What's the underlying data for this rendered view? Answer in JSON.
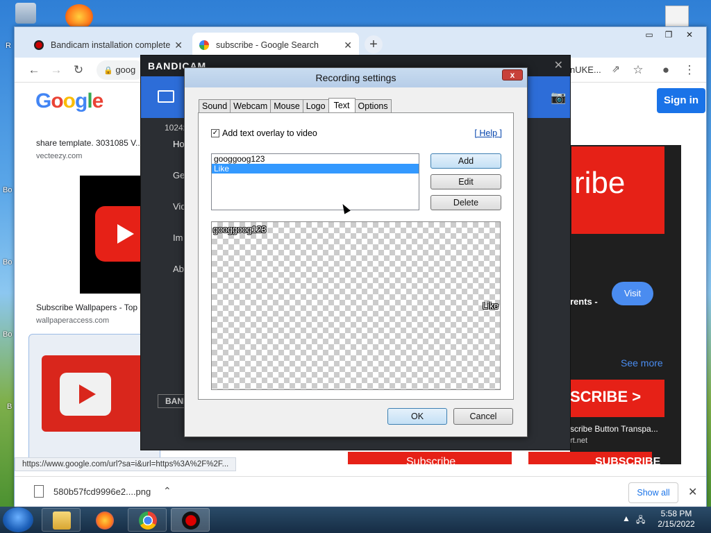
{
  "desktop": {
    "labels": [
      "R",
      "Bo",
      "Bo",
      "Bo",
      "B"
    ]
  },
  "browser": {
    "tabs": [
      {
        "label": "Bandicam installation completed",
        "active": false,
        "favicon": "bandicam-record-icon"
      },
      {
        "label": "subscribe - Google Search",
        "active": true,
        "favicon": "google-g-icon"
      }
    ],
    "new_tab": "+",
    "omnibox_text": "goog",
    "omnibox_right": "nUKE...",
    "status_url": "https://www.google.com/url?sa=i&url=https%3A%2F%2F...",
    "download_file": "580b57fcd9996e2....png",
    "show_all": "Show all"
  },
  "page": {
    "logo_letters": [
      "G",
      "o",
      "o",
      "g",
      "l",
      "e"
    ],
    "logo_colors": [
      "#4285f4",
      "#ea4335",
      "#fbbc05",
      "#4285f4",
      "#34a853",
      "#ea4335"
    ],
    "result1_caption": "share template. 3031085 V...",
    "result1_source": "vecteezy.com",
    "result2_caption": "Subscribe Wallpapers - Top ...",
    "result2_source": "wallpaperaccess.com",
    "right_rents": "rents -",
    "right_visit": "Visit",
    "right_see_more": "See more",
    "right_scribe": "ribe",
    "right_btn_caption": "scribe Button Transpa...",
    "right_btn_source": "rt.net",
    "right_subscribe_banner": "SCRIBE >",
    "right_subscribe2": "Subscribe",
    "right_subscribe3": "SUBSCRIBE",
    "signin": "Sign in"
  },
  "bandicam": {
    "logo": "BANDICAM",
    "size_label": "1024x",
    "side_items": [
      "Ho",
      "Ge",
      "Vid",
      "Im",
      "Ab"
    ],
    "bottom_logo": "BANI"
  },
  "dialog": {
    "title": "Recording settings",
    "close": "x",
    "tabs": [
      "Sound",
      "Webcam",
      "Mouse",
      "Logo",
      "Text",
      "Options"
    ],
    "selected_tab": "Text",
    "checkbox_label": "Add text overlay to video",
    "checkbox_checked": "✓",
    "help": "[ Help ]",
    "list_items": [
      "googgoog123",
      "Like"
    ],
    "selected_item": "Like",
    "add": "Add",
    "edit": "Edit",
    "delete": "Delete",
    "overlay_text_1": "googgoog123",
    "overlay_text_2": "Like",
    "ok": "OK",
    "cancel": "Cancel"
  },
  "taskbar": {
    "time": "5:58 PM",
    "date": "2/15/2022",
    "apps": [
      "file-explorer-icon",
      "firefox-icon",
      "chrome-icon",
      "bandicam-icon"
    ]
  }
}
